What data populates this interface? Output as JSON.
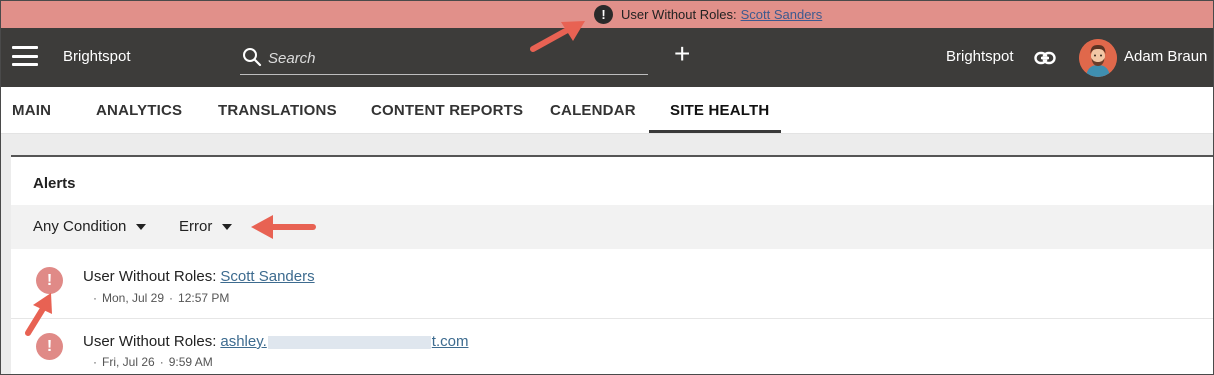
{
  "banner": {
    "icon": "exclamation-icon",
    "text": "User Without Roles:",
    "link": "Scott Sanders"
  },
  "header": {
    "brand": "Brightspot",
    "search_placeholder": "Search",
    "site_name": "Brightspot",
    "user_name": "Adam Braun",
    "colors": {
      "background": "#3d3c3a",
      "banner": "#e1908a"
    }
  },
  "tabs": [
    {
      "label": "MAIN",
      "active": false
    },
    {
      "label": "ANALYTICS",
      "active": false
    },
    {
      "label": "TRANSLATIONS",
      "active": false
    },
    {
      "label": "CONTENT REPORTS",
      "active": false
    },
    {
      "label": "CALENDAR",
      "active": false
    },
    {
      "label": "SITE HEALTH",
      "active": true
    }
  ],
  "alerts_panel": {
    "title": "Alerts",
    "filters": [
      {
        "label": "Any Condition"
      },
      {
        "label": "Error"
      }
    ],
    "items": [
      {
        "title": "User Without Roles:",
        "link": "Scott Sanders",
        "date": "Mon, Jul 29",
        "time": "12:57 PM"
      },
      {
        "title": "User Without Roles:",
        "link_start": "ashley.",
        "link_end": "t.com",
        "date": "Fri, Jul 26",
        "time": "9:59 AM"
      }
    ],
    "colors": {
      "error_icon": "#e08a87",
      "link": "#3d6b8f"
    }
  }
}
